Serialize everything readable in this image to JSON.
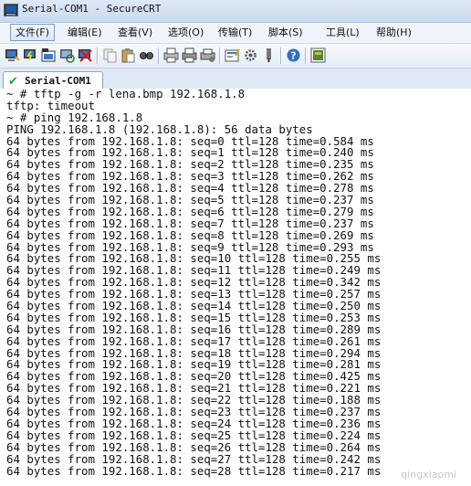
{
  "window": {
    "title": "Serial-COM1 - SecureCRT"
  },
  "menu": [
    {
      "label": "文件(F)",
      "name": "menu-file"
    },
    {
      "label": "编辑(E)",
      "name": "menu-edit"
    },
    {
      "label": "查看(V)",
      "name": "menu-view"
    },
    {
      "label": "选项(O)",
      "name": "menu-options"
    },
    {
      "label": "传输(T)",
      "name": "menu-transfer"
    },
    {
      "label": "脚本(S)",
      "name": "menu-script"
    },
    {
      "label": "工具(L)",
      "name": "menu-tools"
    },
    {
      "label": "帮助(H)",
      "name": "menu-help"
    }
  ],
  "toolbar_icons": [
    "connect-icon",
    "quick-connect-icon",
    "connect-tab-icon",
    "reconnect-icon",
    "disconnect-icon",
    "copy-icon",
    "paste-icon",
    "find-icon",
    "print-screen-icon",
    "print-icon",
    "print-setup-icon",
    "session-options-icon",
    "global-options-icon",
    "keymap-icon",
    "help-icon",
    "sftp-icon"
  ],
  "tab": {
    "label": "Serial-COM1",
    "status_color": "#2e9d2e"
  },
  "terminal": {
    "lines": [
      "~ # tftp -g -r lena.bmp 192.168.1.8",
      "tftp: timeout",
      "~ # ping 192.168.1.8",
      "PING 192.168.1.8 (192.168.1.8): 56 data bytes",
      "64 bytes from 192.168.1.8: seq=0 ttl=128 time=0.584 ms",
      "64 bytes from 192.168.1.8: seq=1 ttl=128 time=0.240 ms",
      "64 bytes from 192.168.1.8: seq=2 ttl=128 time=0.235 ms",
      "64 bytes from 192.168.1.8: seq=3 ttl=128 time=0.262 ms",
      "64 bytes from 192.168.1.8: seq=4 ttl=128 time=0.278 ms",
      "64 bytes from 192.168.1.8: seq=5 ttl=128 time=0.237 ms",
      "64 bytes from 192.168.1.8: seq=6 ttl=128 time=0.279 ms",
      "64 bytes from 192.168.1.8: seq=7 ttl=128 time=0.237 ms",
      "64 bytes from 192.168.1.8: seq=8 ttl=128 time=0.269 ms",
      "64 bytes from 192.168.1.8: seq=9 ttl=128 time=0.293 ms",
      "64 bytes from 192.168.1.8: seq=10 ttl=128 time=0.255 ms",
      "64 bytes from 192.168.1.8: seq=11 ttl=128 time=0.249 ms",
      "64 bytes from 192.168.1.8: seq=12 ttl=128 time=0.342 ms",
      "64 bytes from 192.168.1.8: seq=13 ttl=128 time=0.257 ms",
      "64 bytes from 192.168.1.8: seq=14 ttl=128 time=0.250 ms",
      "64 bytes from 192.168.1.8: seq=15 ttl=128 time=0.253 ms",
      "64 bytes from 192.168.1.8: seq=16 ttl=128 time=0.289 ms",
      "64 bytes from 192.168.1.8: seq=17 ttl=128 time=0.261 ms",
      "64 bytes from 192.168.1.8: seq=18 ttl=128 time=0.294 ms",
      "64 bytes from 192.168.1.8: seq=19 ttl=128 time=0.281 ms",
      "64 bytes from 192.168.1.8: seq=20 ttl=128 time=0.425 ms",
      "64 bytes from 192.168.1.8: seq=21 ttl=128 time=0.221 ms",
      "64 bytes from 192.168.1.8: seq=22 ttl=128 time=0.188 ms",
      "64 bytes from 192.168.1.8: seq=23 ttl=128 time=0.237 ms",
      "64 bytes from 192.168.1.8: seq=24 ttl=128 time=0.236 ms",
      "64 bytes from 192.168.1.8: seq=25 ttl=128 time=0.224 ms",
      "64 bytes from 192.168.1.8: seq=26 ttl=128 time=0.264 ms",
      "64 bytes from 192.168.1.8: seq=27 ttl=128 time=0.242 ms",
      "64 bytes from 192.168.1.8: seq=28 ttl=128 time=0.217 ms"
    ]
  },
  "watermark": "qingxiaomi"
}
